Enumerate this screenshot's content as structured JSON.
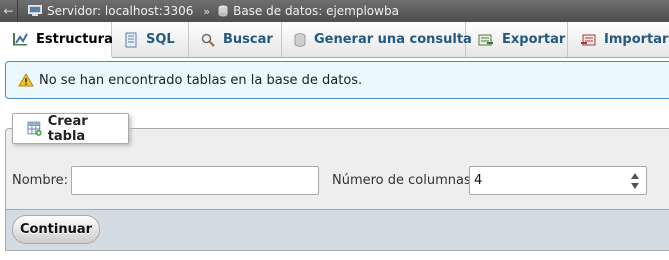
{
  "breadcrumb": {
    "back_glyph": "←",
    "server_label": "Servidor: localhost:3306",
    "separator": "»",
    "database_label": "Base de datos: ejemplowba"
  },
  "tabs": [
    {
      "label": "Estructura",
      "icon": "structure-icon",
      "active": true
    },
    {
      "label": "SQL",
      "icon": "sql-icon",
      "active": false
    },
    {
      "label": "Buscar",
      "icon": "search-icon",
      "active": false
    },
    {
      "label": "Generar una consulta",
      "icon": "query-icon",
      "active": false
    },
    {
      "label": "Exportar",
      "icon": "export-icon",
      "active": false
    },
    {
      "label": "Importar",
      "icon": "import-icon",
      "active": false
    }
  ],
  "notice": {
    "text": "No se han encontrado tablas en la base de datos.",
    "icon": "warning-icon"
  },
  "create_table": {
    "legend": "Crear tabla",
    "name_label": "Nombre:",
    "name_value": "",
    "columns_label": "Número de columnas:",
    "columns_value": "4",
    "submit_label": "Continuar"
  },
  "colors": {
    "tab_link": "#235a81",
    "notice_bg": "#ebf8fd",
    "notice_border": "#4a8eb9",
    "footer_bg": "#d3dce3"
  }
}
